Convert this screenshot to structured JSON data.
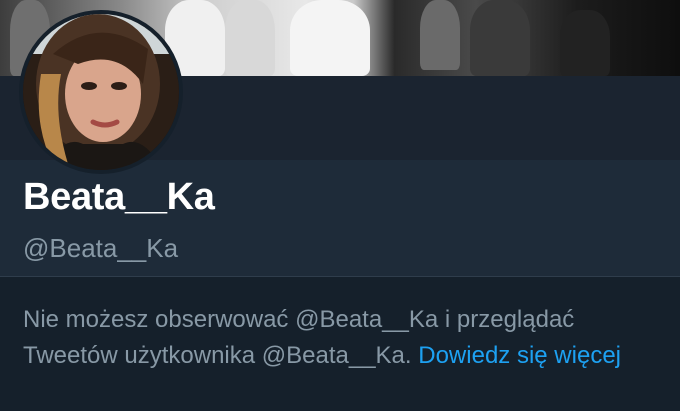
{
  "profile": {
    "display_name": "Beata__Ka",
    "handle": "@Beata__Ka"
  },
  "notice": {
    "text": "Nie możesz obserwować @Beata__Ka i przeglądać Tweetów użytkownika @Beata__Ka. ",
    "link_text": "Dowiedz się więcej"
  },
  "colors": {
    "background": "#15202b",
    "text_primary": "#ffffff",
    "text_secondary": "#8899a6",
    "link": "#1da1f2"
  }
}
